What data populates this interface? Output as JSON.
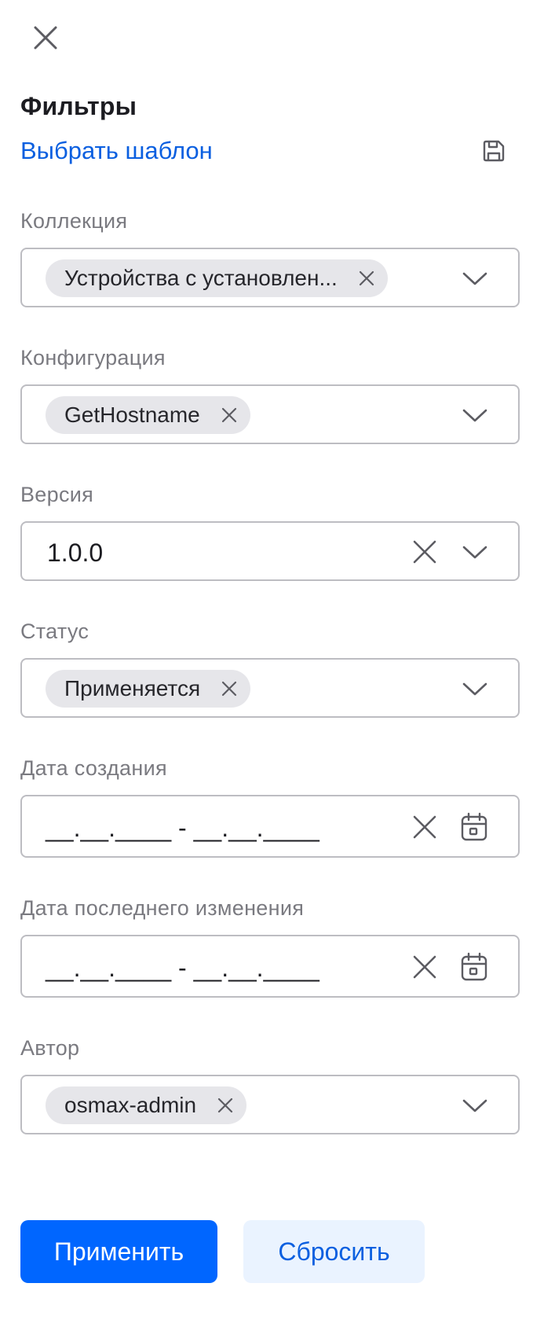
{
  "header": {
    "close_icon": "close-icon",
    "title": "Фильтры",
    "template_link": "Выбрать шаблон",
    "save_icon": "save-icon"
  },
  "fields": {
    "collection": {
      "label": "Коллекция",
      "chip": "Устройства с установлен..."
    },
    "configuration": {
      "label": "Конфигурация",
      "chip": "GetHostname"
    },
    "version": {
      "label": "Версия",
      "value": "1.0.0"
    },
    "status": {
      "label": "Статус",
      "chip": "Применяется"
    },
    "created": {
      "label": "Дата создания",
      "mask": "__.__.____ - __.__.____"
    },
    "modified": {
      "label": "Дата последнего изменения",
      "mask": "__.__.____ - __.__.____"
    },
    "author": {
      "label": "Автор",
      "chip": "osmax-admin"
    }
  },
  "footer": {
    "apply_label": "Применить",
    "reset_label": "Сбросить"
  },
  "colors": {
    "accent": "#0066ff",
    "link": "#0a5fe0",
    "reset_bg": "#eaf3ff",
    "chip_bg": "#e6e6ea",
    "border": "#bdbdc2",
    "label": "#7a7a80"
  }
}
